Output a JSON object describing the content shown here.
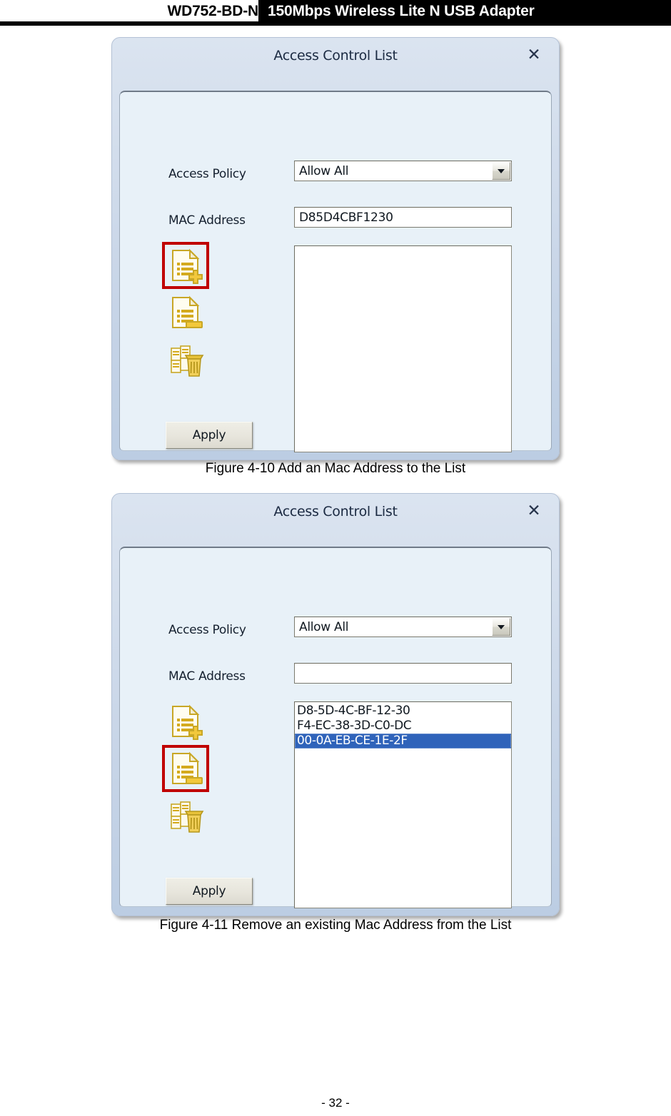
{
  "header": {
    "model": "WD752-BD-N",
    "product": "150Mbps Wireless Lite N USB Adapter"
  },
  "dialogs": [
    {
      "title": "Access Control List",
      "close_label": "✕",
      "access_policy_label": "Access Policy",
      "access_policy_value": "Allow All",
      "mac_address_label": "MAC Address",
      "mac_address_value": "D85D4CBF1230",
      "apply_label": "Apply",
      "list_items": [],
      "icons": [
        {
          "name": "add-mac-address-icon",
          "highlighted": true
        },
        {
          "name": "remove-mac-address-icon",
          "highlighted": false
        },
        {
          "name": "delete-all-mac-addresses-icon",
          "highlighted": false
        }
      ]
    },
    {
      "title": "Access Control List",
      "close_label": "✕",
      "access_policy_label": "Access Policy",
      "access_policy_value": "Allow All",
      "mac_address_label": "MAC Address",
      "mac_address_value": "",
      "apply_label": "Apply",
      "list_items": [
        {
          "text": "D8-5D-4C-BF-12-30",
          "selected": false
        },
        {
          "text": "F4-EC-38-3D-C0-DC",
          "selected": false
        },
        {
          "text": "00-0A-EB-CE-1E-2F",
          "selected": true
        }
      ],
      "icons": [
        {
          "name": "add-mac-address-icon",
          "highlighted": false
        },
        {
          "name": "remove-mac-address-icon",
          "highlighted": true
        },
        {
          "name": "delete-all-mac-addresses-icon",
          "highlighted": false
        }
      ]
    }
  ],
  "captions": [
    "Figure 4-10 Add an Mac Address to the List",
    "Figure 4-11 Remove an existing Mac Address from the List"
  ],
  "footer": {
    "page_number": "- 32 -"
  },
  "colors": {
    "highlight_border": "#c00000",
    "list_selection": "#2f63ba",
    "titlebar_top": "#dbe4f0",
    "panel_background": "#e8f1f8"
  },
  "dropdown_options": [
    "Allow All"
  ]
}
